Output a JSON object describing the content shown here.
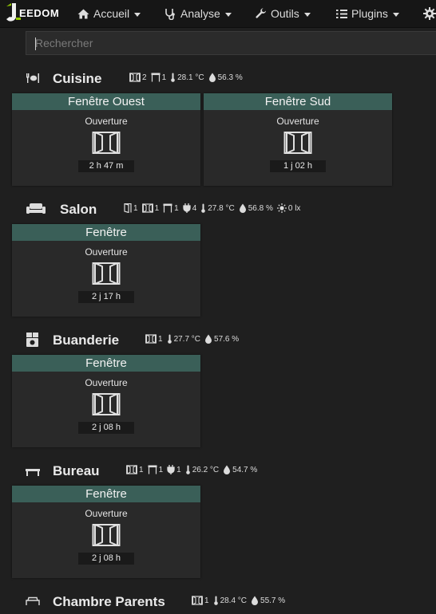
{
  "navbar": {
    "logo_text": "EEDOM",
    "items": [
      {
        "label": "Accueil",
        "icon": "home-icon"
      },
      {
        "label": "Analyse",
        "icon": "stethoscope-icon"
      },
      {
        "label": "Outils",
        "icon": "wrench-icon"
      },
      {
        "label": "Plugins",
        "icon": "tasks-icon"
      }
    ],
    "settings_icon": "gear-icon"
  },
  "search": {
    "placeholder": "Rechercher",
    "value": ""
  },
  "rooms": [
    {
      "name": "Cuisine",
      "icon": "cutlery-icon",
      "summary": {
        "windows": "2",
        "shutters": "1",
        "temperature": "28.1 °C",
        "humidity": "56.3 %"
      },
      "cards": [
        {
          "title": "Fenêtre Ouest",
          "cmd": "Ouverture",
          "duration": "2 h 47 m"
        },
        {
          "title": "Fenêtre Sud",
          "cmd": "Ouverture",
          "duration": "1 j 02 h"
        }
      ]
    },
    {
      "name": "Salon",
      "icon": "sofa-icon",
      "summary": {
        "doors": "1",
        "windows": "1",
        "shutters": "1",
        "plugs": "4",
        "temperature": "27.8 °C",
        "humidity": "56.8 %",
        "luminosity": "0 lx"
      },
      "cards": [
        {
          "title": "Fenêtre",
          "cmd": "Ouverture",
          "duration": "2 j 17 h"
        }
      ]
    },
    {
      "name": "Buanderie",
      "icon": "laundry-icon",
      "summary": {
        "windows": "1",
        "temperature": "27.7 °C",
        "humidity": "57.6 %"
      },
      "cards": [
        {
          "title": "Fenêtre",
          "cmd": "Ouverture",
          "duration": "2 j 08 h"
        }
      ]
    },
    {
      "name": "Bureau",
      "icon": "desk-icon",
      "summary": {
        "windows": "1",
        "shutters": "1",
        "plugs": "1",
        "temperature": "26.2 °C",
        "humidity": "54.7 %"
      },
      "cards": [
        {
          "title": "Fenêtre",
          "cmd": "Ouverture",
          "duration": "2 j 08 h"
        }
      ]
    },
    {
      "name": "Chambre Parents",
      "icon": "bed-icon",
      "summary": {
        "windows": "1",
        "temperature": "28.4 °C",
        "humidity": "55.7 %"
      },
      "cards": []
    }
  ],
  "colors": {
    "background": "#1f1f1f",
    "navbar": "#161616",
    "card_title": "#3a5f58",
    "card_body": "#292929",
    "logo_accent": "#94ca02"
  }
}
